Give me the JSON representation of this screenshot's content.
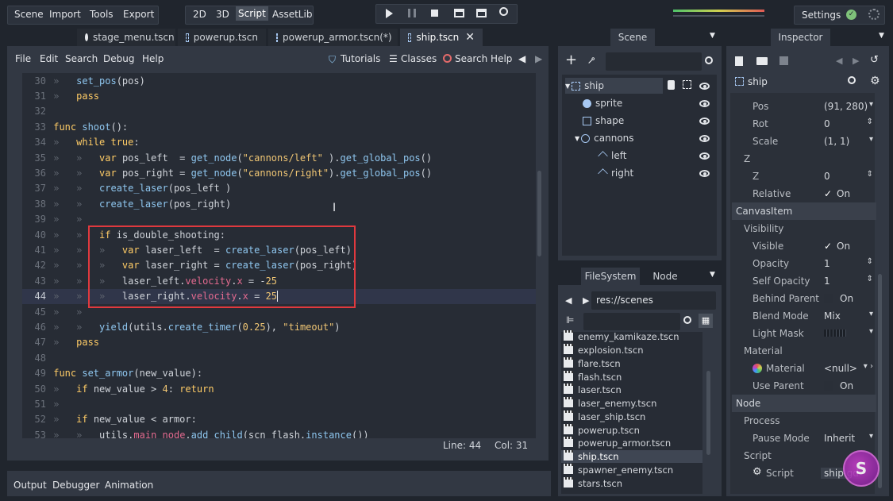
{
  "topbar": {
    "menus": [
      "Scene",
      "Import",
      "Tools",
      "Export"
    ],
    "workspaces": [
      "2D",
      "3D",
      "Script",
      "AssetLib"
    ],
    "active_workspace": "Script",
    "settings": "Settings"
  },
  "tabs": [
    {
      "label": "stage_menu.tscn",
      "icon": "circle-node-icon"
    },
    {
      "label": "powerup.tscn",
      "icon": "node2d-icon"
    },
    {
      "label": "powerup_armor.tscn(*)",
      "icon": "node2d-icon"
    },
    {
      "label": "ship.tscn",
      "icon": "node2d-icon",
      "active": true
    }
  ],
  "script_menu": [
    "File",
    "Edit",
    "Search",
    "Debug",
    "Help"
  ],
  "script_toolbar": {
    "tutorials": "Tutorials",
    "classes": "Classes",
    "search_help": "Search Help"
  },
  "code": [
    {
      "n": "30",
      "ind": 1,
      "parts": [
        [
          "fn",
          "set_pos"
        ],
        [
          "txt",
          "(pos)"
        ]
      ]
    },
    {
      "n": "31",
      "ind": 1,
      "parts": [
        [
          "kw",
          "pass"
        ]
      ]
    },
    {
      "n": "32",
      "ind": 0,
      "parts": []
    },
    {
      "n": "33",
      "ind": 0,
      "parts": [
        [
          "kw",
          "func "
        ],
        [
          "fn",
          "shoot"
        ],
        [
          "txt",
          "():"
        ]
      ]
    },
    {
      "n": "34",
      "ind": 1,
      "parts": [
        [
          "kw",
          "while true"
        ],
        [
          "txt",
          ":"
        ]
      ]
    },
    {
      "n": "35",
      "ind": 2,
      "parts": [
        [
          "kw",
          "var "
        ],
        [
          "txt",
          "pos_left  = "
        ],
        [
          "fn",
          "get_node"
        ],
        [
          "txt",
          "("
        ],
        [
          "str",
          "\"cannons/left\""
        ],
        [
          "txt",
          " )."
        ],
        [
          "fn",
          "get_global_pos"
        ],
        [
          "txt",
          "()"
        ]
      ]
    },
    {
      "n": "36",
      "ind": 2,
      "parts": [
        [
          "kw",
          "var "
        ],
        [
          "txt",
          "pos_right = "
        ],
        [
          "fn",
          "get_node"
        ],
        [
          "txt",
          "("
        ],
        [
          "str",
          "\"cannons/right\""
        ],
        [
          "txt",
          ")."
        ],
        [
          "fn",
          "get_global_pos"
        ],
        [
          "txt",
          "()"
        ]
      ]
    },
    {
      "n": "37",
      "ind": 2,
      "parts": [
        [
          "fn",
          "create_laser"
        ],
        [
          "txt",
          "(pos_left )"
        ]
      ]
    },
    {
      "n": "38",
      "ind": 2,
      "parts": [
        [
          "fn",
          "create_laser"
        ],
        [
          "txt",
          "(pos_right)"
        ]
      ]
    },
    {
      "n": "39",
      "ind": 2,
      "parts": []
    },
    {
      "n": "40",
      "ind": 2,
      "parts": [
        [
          "kw",
          "if "
        ],
        [
          "txt",
          "is_double_shooting:"
        ]
      ]
    },
    {
      "n": "41",
      "ind": 3,
      "parts": [
        [
          "kw",
          "var "
        ],
        [
          "txt",
          "laser_left  = "
        ],
        [
          "fn",
          "create_laser"
        ],
        [
          "txt",
          "(pos_left)"
        ]
      ]
    },
    {
      "n": "42",
      "ind": 3,
      "parts": [
        [
          "kw",
          "var "
        ],
        [
          "txt",
          "laser_right = "
        ],
        [
          "fn",
          "create_laser"
        ],
        [
          "txt",
          "(pos_right)"
        ]
      ]
    },
    {
      "n": "43",
      "ind": 3,
      "parts": [
        [
          "txt",
          "laser_left."
        ],
        [
          "mem",
          "velocity"
        ],
        [
          "txt",
          "."
        ],
        [
          "mem",
          "x"
        ],
        [
          "txt",
          " = -"
        ],
        [
          "num",
          "25"
        ]
      ]
    },
    {
      "n": "44",
      "ind": 3,
      "parts": [
        [
          "txt",
          "laser_right."
        ],
        [
          "mem",
          "velocity"
        ],
        [
          "txt",
          "."
        ],
        [
          "mem",
          "x"
        ],
        [
          "txt",
          " = "
        ],
        [
          "num",
          "25"
        ]
      ],
      "current": true
    },
    {
      "n": "45",
      "ind": 2,
      "parts": []
    },
    {
      "n": "46",
      "ind": 2,
      "parts": [
        [
          "fn",
          "yield"
        ],
        [
          "txt",
          "(utils."
        ],
        [
          "fn",
          "create_timer"
        ],
        [
          "txt",
          "("
        ],
        [
          "num",
          "0.25"
        ],
        [
          "txt",
          "), "
        ],
        [
          "str",
          "\"timeout\""
        ],
        [
          "txt",
          ")"
        ]
      ]
    },
    {
      "n": "47",
      "ind": 1,
      "parts": [
        [
          "kw",
          "pass"
        ]
      ]
    },
    {
      "n": "48",
      "ind": 0,
      "parts": []
    },
    {
      "n": "49",
      "ind": 0,
      "parts": [
        [
          "kw",
          "func "
        ],
        [
          "fn",
          "set_armor"
        ],
        [
          "txt",
          "(new_value):"
        ]
      ]
    },
    {
      "n": "50",
      "ind": 1,
      "parts": [
        [
          "kw",
          "if "
        ],
        [
          "txt",
          "new_value > "
        ],
        [
          "num",
          "4"
        ],
        [
          "txt",
          ": "
        ],
        [
          "kw",
          "return"
        ]
      ]
    },
    {
      "n": "51",
      "ind": 1,
      "parts": []
    },
    {
      "n": "52",
      "ind": 1,
      "parts": [
        [
          "kw",
          "if "
        ],
        [
          "txt",
          "new_value < armor:"
        ]
      ]
    },
    {
      "n": "53",
      "ind": 2,
      "parts": [
        [
          "txt",
          "utils."
        ],
        [
          "mem",
          "main_node"
        ],
        [
          "txt",
          "."
        ],
        [
          "fn",
          "add_child"
        ],
        [
          "txt",
          "(scn_flash."
        ],
        [
          "fn",
          "instance"
        ],
        [
          "txt",
          "())"
        ]
      ]
    }
  ],
  "status": {
    "line": "Line: 44",
    "col": "Col: 31"
  },
  "bottom_tabs": [
    "Output",
    "Debugger",
    "Animation"
  ],
  "scene": {
    "title": "Scene",
    "nodes": [
      {
        "label": "ship",
        "depth": 0,
        "icon": "node2d-icon"
      },
      {
        "label": "sprite",
        "depth": 1,
        "icon": "sprite-icon"
      },
      {
        "label": "shape",
        "depth": 1,
        "icon": "shape-icon"
      },
      {
        "label": "cannons",
        "depth": 1,
        "icon": "circle-node-icon"
      },
      {
        "label": "left",
        "depth": 2,
        "icon": "position-icon"
      },
      {
        "label": "right",
        "depth": 2,
        "icon": "position-icon"
      }
    ]
  },
  "filesystem": {
    "tabs": [
      "FileSystem",
      "Node"
    ],
    "path": "res://scenes",
    "files": [
      "enemy_kamikaze.tscn",
      "explosion.tscn",
      "flare.tscn",
      "flash.tscn",
      "laser.tscn",
      "laser_enemy.tscn",
      "laser_ship.tscn",
      "powerup.tscn",
      "powerup_armor.tscn",
      "ship.tscn",
      "spawner_enemy.tscn",
      "stars.tscn"
    ],
    "selected": "ship.tscn"
  },
  "inspector": {
    "title": "Inspector",
    "object": "ship",
    "rows": [
      {
        "type": "prop",
        "label": "Pos",
        "value": "(91, 280)",
        "ctl": "▾"
      },
      {
        "type": "prop",
        "label": "Rot",
        "value": "0",
        "ctl": "⇕"
      },
      {
        "type": "prop",
        "label": "Scale",
        "value": "(1, 1)",
        "ctl": "▾"
      },
      {
        "type": "sub",
        "label": "Z"
      },
      {
        "type": "prop",
        "label": "Z",
        "value": "0",
        "ctl": "⇕"
      },
      {
        "type": "check",
        "label": "Relative",
        "value": "On",
        "checked": true
      },
      {
        "type": "section",
        "label": "CanvasItem"
      },
      {
        "type": "sub",
        "label": "Visibility"
      },
      {
        "type": "check",
        "label": "Visible",
        "value": "On",
        "checked": true
      },
      {
        "type": "prop",
        "label": "Opacity",
        "value": "1",
        "ctl": "⇕"
      },
      {
        "type": "prop",
        "label": "Self Opacity",
        "value": "1",
        "ctl": "⇕"
      },
      {
        "type": "check",
        "label": "Behind Parent",
        "value": "On",
        "checked": false
      },
      {
        "type": "prop",
        "label": "Blend Mode",
        "value": "Mix",
        "ctl": "▾"
      },
      {
        "type": "prop",
        "label": "Light Mask",
        "value": "",
        "ctl": "▾"
      },
      {
        "type": "sub",
        "label": "Material"
      },
      {
        "type": "prop",
        "label": "Material",
        "value": "<null>",
        "ctl": "▾ ›",
        "icon": true
      },
      {
        "type": "check",
        "label": "Use Parent",
        "value": "On",
        "checked": false
      },
      {
        "type": "section",
        "label": "Node"
      },
      {
        "type": "sub",
        "label": "Process"
      },
      {
        "type": "prop",
        "label": "Pause Mode",
        "value": "Inherit",
        "ctl": "▾"
      },
      {
        "type": "sub",
        "label": "Script"
      },
      {
        "type": "prop",
        "label": "Script",
        "value": "ship.gd",
        "ctl": "",
        "gear": true
      }
    ]
  },
  "colors": {
    "accent": "#3b98ff",
    "highlight_box": "#e0393e",
    "keyword": "#ffcc66",
    "function": "#8fc7f0",
    "member": "#e36a8f"
  }
}
